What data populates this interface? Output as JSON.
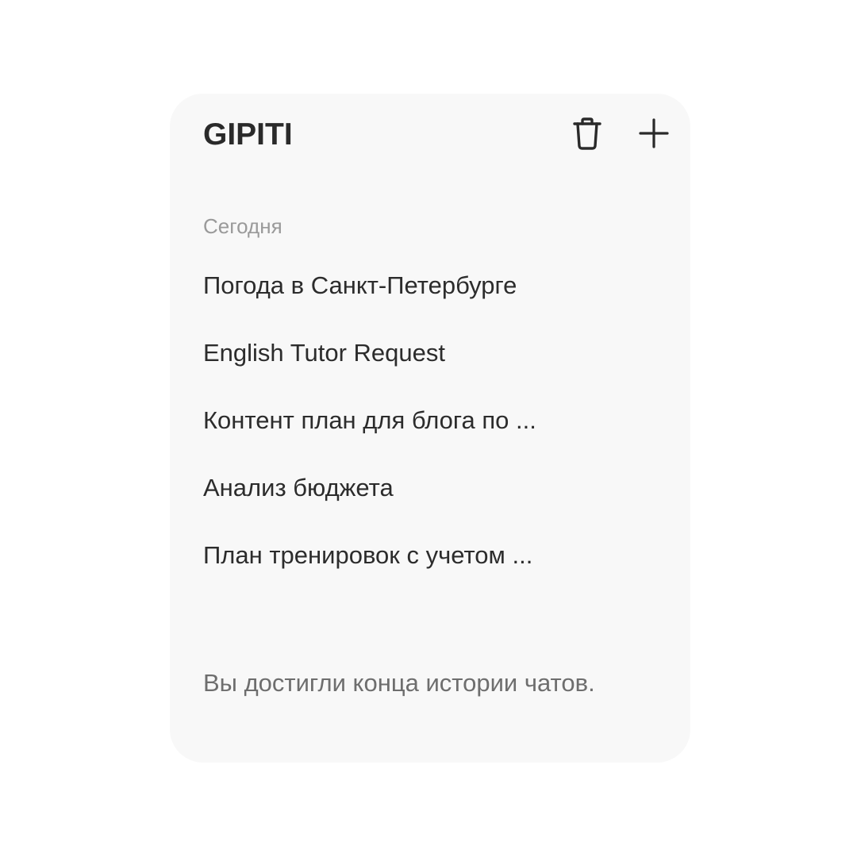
{
  "header": {
    "title": "GIPITI",
    "trash_icon": "trash-icon",
    "plus_icon": "plus-icon"
  },
  "history": {
    "section_label": "Сегодня",
    "items": [
      {
        "label": "Погода в Санкт-Петербурге"
      },
      {
        "label": "English Tutor Request"
      },
      {
        "label": "Контент план для блога по ..."
      },
      {
        "label": "Анализ бюджета"
      },
      {
        "label": "План тренировок с учетом ..."
      }
    ],
    "end_note": "Вы достигли конца истории чатов."
  },
  "colors": {
    "panel_background": "#f8f8f8",
    "title_text": "#2a2a2a",
    "item_text": "#2c2c2c",
    "muted_text": "#9a9a9a"
  }
}
